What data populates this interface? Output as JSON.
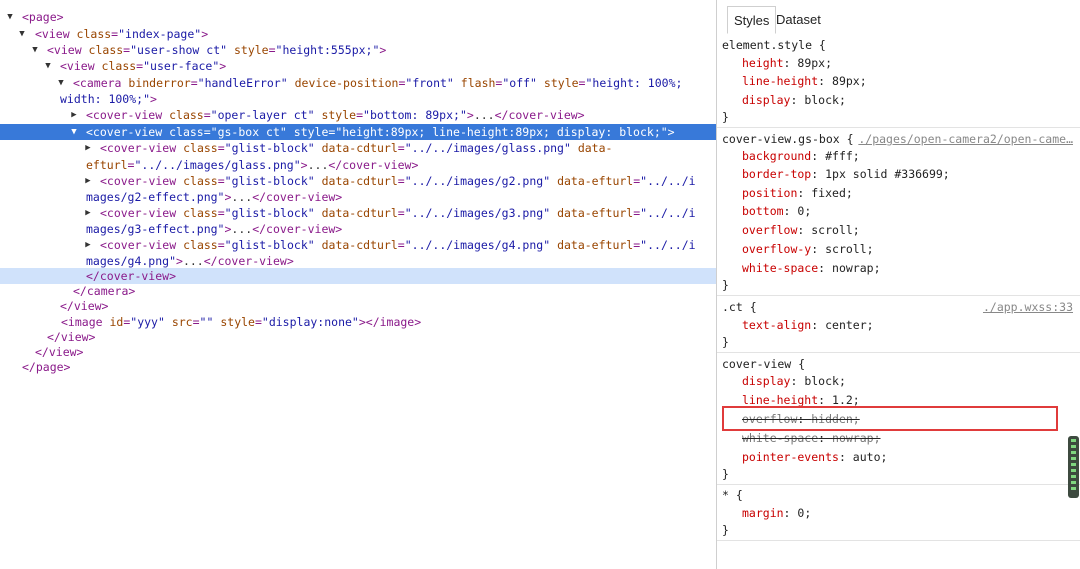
{
  "tree": {
    "lines": [
      [
        "▼",
        [
          "tag",
          "<page>"
        ]
      ],
      [
        "▼",
        [
          "tag",
          "<view "
        ],
        [
          "an",
          "class"
        ],
        [
          "tag",
          "="
        ],
        [
          "av",
          "\"index-page\""
        ],
        [
          "tag",
          ">"
        ]
      ],
      [
        "▼",
        [
          "tag",
          "<view "
        ],
        [
          "an",
          "class"
        ],
        [
          "tag",
          "="
        ],
        [
          "av",
          "\"user-show ct\""
        ],
        [
          "tag",
          " "
        ],
        [
          "an",
          "style"
        ],
        [
          "tag",
          "="
        ],
        [
          "av",
          "\"height:555px;\""
        ],
        [
          "tag",
          ">"
        ]
      ],
      [
        "▼",
        [
          "tag",
          "<view "
        ],
        [
          "an",
          "class"
        ],
        [
          "tag",
          "="
        ],
        [
          "av",
          "\"user-face\""
        ],
        [
          "tag",
          ">"
        ]
      ],
      [
        "▼",
        [
          "tag",
          "<camera "
        ],
        [
          "an",
          "binderror"
        ],
        [
          "tag",
          "="
        ],
        [
          "av",
          "\"handleError\""
        ],
        [
          "tag",
          " "
        ],
        [
          "an",
          "device-position"
        ],
        [
          "tag",
          "="
        ],
        [
          "av",
          "\"front\""
        ],
        [
          "tag",
          " "
        ],
        [
          "an",
          "flash"
        ],
        [
          "tag",
          "="
        ],
        [
          "av",
          "\"off\""
        ],
        [
          "tag",
          " "
        ],
        [
          "an",
          "style"
        ],
        [
          "tag",
          "="
        ],
        [
          "av",
          "\"height: 100%;"
        ]
      ],
      [
        "",
        [
          "av",
          "width: 100%;\""
        ],
        [
          "tag",
          ">"
        ]
      ],
      [
        "▶",
        [
          "tag",
          "<cover-view "
        ],
        [
          "an",
          "class"
        ],
        [
          "tag",
          "="
        ],
        [
          "av",
          "\"oper-layer ct\""
        ],
        [
          "tag",
          " "
        ],
        [
          "an",
          "style"
        ],
        [
          "tag",
          "="
        ],
        [
          "av",
          "\"bottom: 89px;\""
        ],
        [
          "tag",
          ">"
        ],
        [
          "tx",
          "..."
        ],
        [
          "tag",
          "</cover-view>"
        ]
      ],
      [
        "▼",
        [
          "tag",
          "<cover-view "
        ],
        [
          "an",
          "class"
        ],
        [
          "tag",
          "="
        ],
        [
          "av",
          "\"gs-box ct\""
        ],
        [
          "tag",
          " "
        ],
        [
          "an",
          "style"
        ],
        [
          "tag",
          "="
        ],
        [
          "av",
          "\"height:89px; line-height:89px; display: block;\""
        ],
        [
          "tag",
          ">"
        ]
      ],
      [
        "▶",
        [
          "tag",
          "<cover-view "
        ],
        [
          "an",
          "class"
        ],
        [
          "tag",
          "="
        ],
        [
          "av",
          "\"glist-block\""
        ],
        [
          "tag",
          " "
        ],
        [
          "an",
          "data-cdturl"
        ],
        [
          "tag",
          "="
        ],
        [
          "av",
          "\"../../images/glass.png\""
        ],
        [
          "tag",
          " "
        ],
        [
          "an",
          "data-"
        ]
      ],
      [
        "",
        [
          "an",
          "efturl"
        ],
        [
          "tag",
          "="
        ],
        [
          "av",
          "\"../../images/glass.png\""
        ],
        [
          "tag",
          ">"
        ],
        [
          "tx",
          "..."
        ],
        [
          "tag",
          "</cover-view>"
        ]
      ],
      [
        "▶",
        [
          "tag",
          "<cover-view "
        ],
        [
          "an",
          "class"
        ],
        [
          "tag",
          "="
        ],
        [
          "av",
          "\"glist-block\""
        ],
        [
          "tag",
          " "
        ],
        [
          "an",
          "data-cdturl"
        ],
        [
          "tag",
          "="
        ],
        [
          "av",
          "\"../../images/g2.png\""
        ],
        [
          "tag",
          " "
        ],
        [
          "an",
          "data-efturl"
        ],
        [
          "tag",
          "="
        ],
        [
          "av",
          "\"../../i"
        ]
      ],
      [
        "",
        [
          "av",
          "mages/g2-effect.png\""
        ],
        [
          "tag",
          ">"
        ],
        [
          "tx",
          "..."
        ],
        [
          "tag",
          "</cover-view>"
        ]
      ],
      [
        "▶",
        [
          "tag",
          "<cover-view "
        ],
        [
          "an",
          "class"
        ],
        [
          "tag",
          "="
        ],
        [
          "av",
          "\"glist-block\""
        ],
        [
          "tag",
          " "
        ],
        [
          "an",
          "data-cdturl"
        ],
        [
          "tag",
          "="
        ],
        [
          "av",
          "\"../../images/g3.png\""
        ],
        [
          "tag",
          " "
        ],
        [
          "an",
          "data-efturl"
        ],
        [
          "tag",
          "="
        ],
        [
          "av",
          "\"../../i"
        ]
      ],
      [
        "",
        [
          "av",
          "mages/g3-effect.png\""
        ],
        [
          "tag",
          ">"
        ],
        [
          "tx",
          "..."
        ],
        [
          "tag",
          "</cover-view>"
        ]
      ],
      [
        "▶",
        [
          "tag",
          "<cover-view "
        ],
        [
          "an",
          "class"
        ],
        [
          "tag",
          "="
        ],
        [
          "av",
          "\"glist-block\""
        ],
        [
          "tag",
          " "
        ],
        [
          "an",
          "data-cdturl"
        ],
        [
          "tag",
          "="
        ],
        [
          "av",
          "\"../../images/g4.png\""
        ],
        [
          "tag",
          " "
        ],
        [
          "an",
          "data-efturl"
        ],
        [
          "tag",
          "="
        ],
        [
          "av",
          "\"../../i"
        ]
      ],
      [
        "",
        [
          "av",
          "mages/g4.png\""
        ],
        [
          "tag",
          ">"
        ],
        [
          "tx",
          "..."
        ],
        [
          "tag",
          "</cover-view>"
        ]
      ],
      [
        "",
        [
          "tag",
          "</cover-view>"
        ]
      ],
      [
        "",
        [
          "tag",
          "</camera>"
        ]
      ],
      [
        "",
        [
          "tag",
          "</view>"
        ]
      ],
      [
        "",
        [
          "tag",
          "<image "
        ],
        [
          "an",
          "id"
        ],
        [
          "tag",
          "="
        ],
        [
          "av",
          "\"yyy\""
        ],
        [
          "tag",
          " "
        ],
        [
          "an",
          "src"
        ],
        [
          "tag",
          "="
        ],
        [
          "av",
          "\"\""
        ],
        [
          "tag",
          " "
        ],
        [
          "an",
          "style"
        ],
        [
          "tag",
          "="
        ],
        [
          "av",
          "\"display:none\""
        ],
        [
          "tag",
          "></image>"
        ]
      ],
      [
        "",
        [
          "tag",
          "</view>"
        ]
      ],
      [
        "",
        [
          "tag",
          "</view>"
        ]
      ],
      [
        "",
        [
          "tag",
          "</page>"
        ]
      ]
    ]
  },
  "styles": {
    "tabs": [
      "Styles",
      "Dataset"
    ],
    "element_style": {
      "selector": "element.style {",
      "props": [
        [
          "height",
          "89px;"
        ],
        [
          "line-height",
          "89px;"
        ],
        [
          "display",
          "block;"
        ]
      ],
      "close": "}"
    },
    "gs_box_rule": {
      "selector": "cover-view.gs-box {",
      "source": "./pages/open-camera2/open-came…",
      "props": [
        [
          "background",
          "#fff;"
        ],
        [
          "border-top",
          "1px solid #336699;"
        ],
        [
          "position",
          "fixed;"
        ],
        [
          "bottom",
          "0;"
        ],
        [
          "overflow",
          "scroll;"
        ],
        [
          "overflow-y",
          "scroll;"
        ],
        [
          "white-space",
          "nowrap;"
        ]
      ],
      "close": "}"
    },
    "ct_rule": {
      "selector": ".ct {",
      "source": "./app.wxss:33",
      "props": [
        [
          "text-align",
          "center;"
        ]
      ],
      "close": "}"
    },
    "cover_view_rule": {
      "selector": "cover-view {",
      "props": [
        [
          "display",
          "block;"
        ],
        [
          "line-height",
          "1.2;"
        ],
        [
          "overflow",
          "hidden;"
        ],
        [
          "white-space",
          "nowrap;"
        ],
        [
          "pointer-events",
          "auto;"
        ]
      ],
      "struck": [
        false,
        false,
        true,
        true,
        false
      ],
      "close": "}"
    },
    "universal_rule": {
      "selector": "* {",
      "props": [
        [
          "margin",
          "0;"
        ]
      ],
      "close": "}"
    }
  },
  "colors": {
    "selection": "#3879d9",
    "hover": "#d0e2fb",
    "highlight_box": "#e03b3b"
  }
}
